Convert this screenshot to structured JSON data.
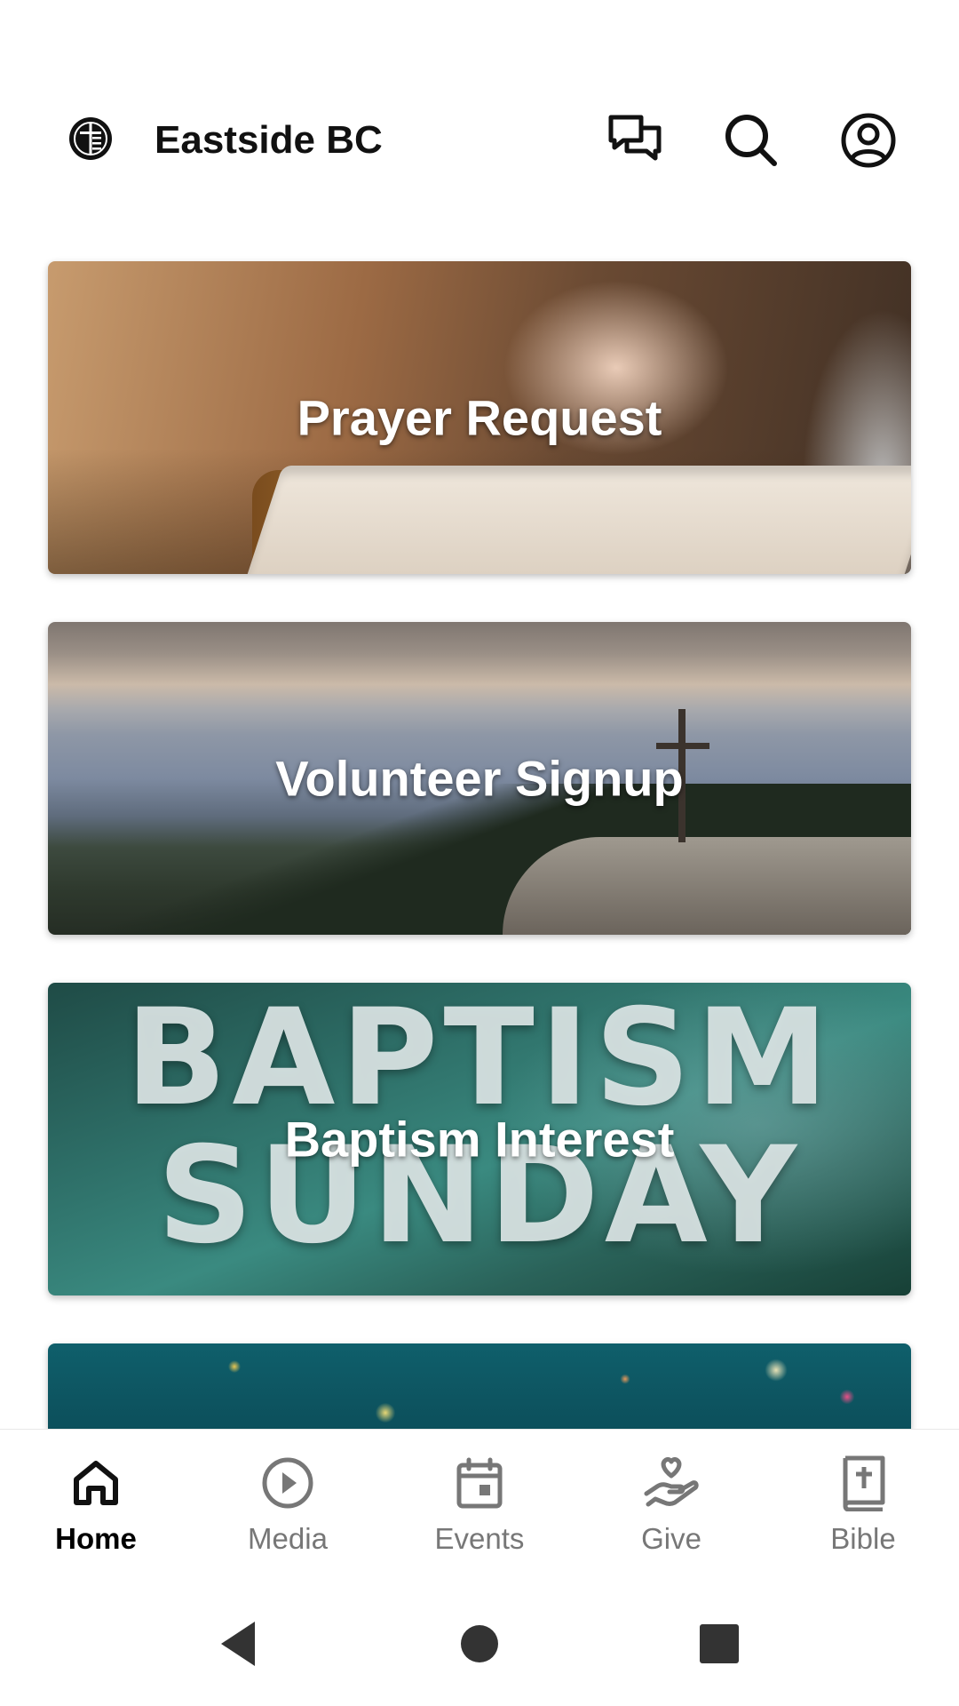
{
  "header": {
    "title": "Eastside BC",
    "logo_icon": "church-logo-icon",
    "actions": [
      {
        "name": "chat-icon"
      },
      {
        "name": "search-icon"
      },
      {
        "name": "profile-icon"
      }
    ]
  },
  "cards": [
    {
      "label": "Prayer Request"
    },
    {
      "label": "Volunteer Signup"
    },
    {
      "label": "Baptism Interest",
      "background_text_line1": "BAPTISM",
      "background_text_line2": "SUNDAY"
    }
  ],
  "bottom_nav": {
    "items": [
      {
        "label": "Home",
        "icon": "home-icon",
        "active": true
      },
      {
        "label": "Media",
        "icon": "play-circle-icon",
        "active": false
      },
      {
        "label": "Events",
        "icon": "calendar-icon",
        "active": false
      },
      {
        "label": "Give",
        "icon": "give-hand-heart-icon",
        "active": false
      },
      {
        "label": "Bible",
        "icon": "bible-icon",
        "active": false
      }
    ]
  },
  "system_nav": {
    "buttons": [
      "back",
      "home",
      "recents"
    ]
  }
}
